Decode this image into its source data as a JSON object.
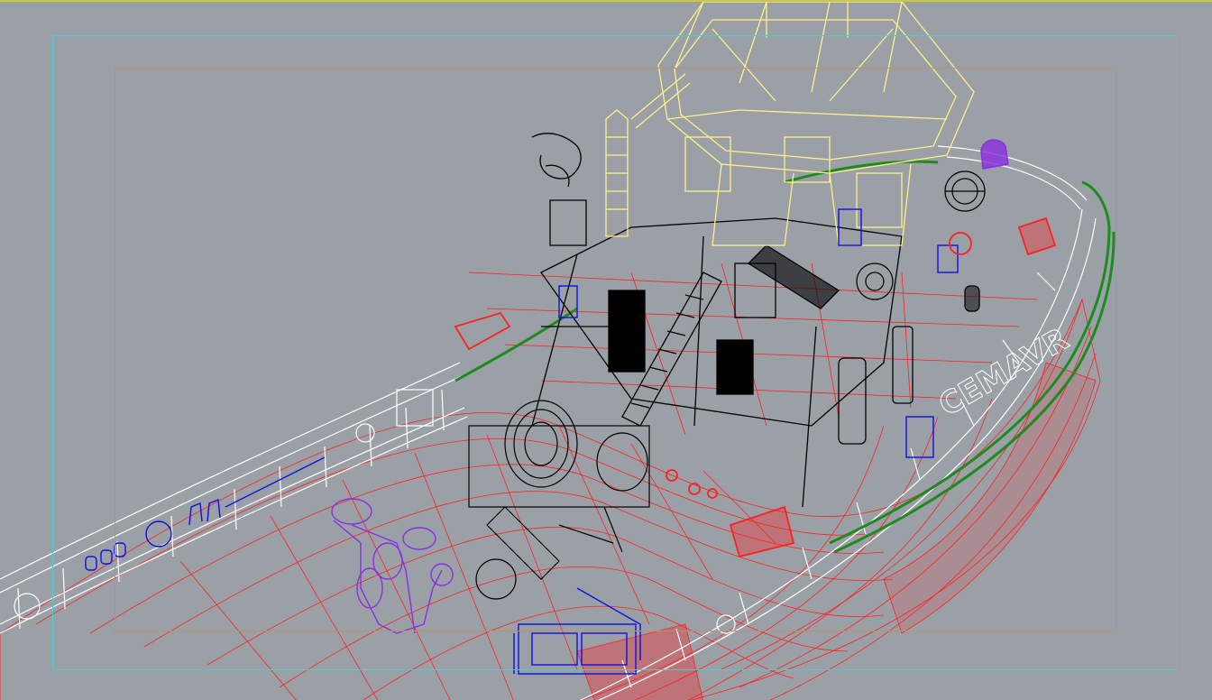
{
  "viewport": {
    "background": "#9aa0a6",
    "shading": "wireframe"
  },
  "hull": {
    "lettering": "CEMAVR",
    "colors": {
      "hull_mesh": "#ff2020",
      "bulwark": "#ffffff",
      "fender": "#1f8a1f",
      "superstructure": "#000000",
      "mast": "#fff08a",
      "fittings": "#1010e0",
      "bitts": "#8a30e0"
    }
  },
  "icons": {
    "capstan_1": "capstan-icon",
    "capstan_2": "capstan-icon"
  }
}
